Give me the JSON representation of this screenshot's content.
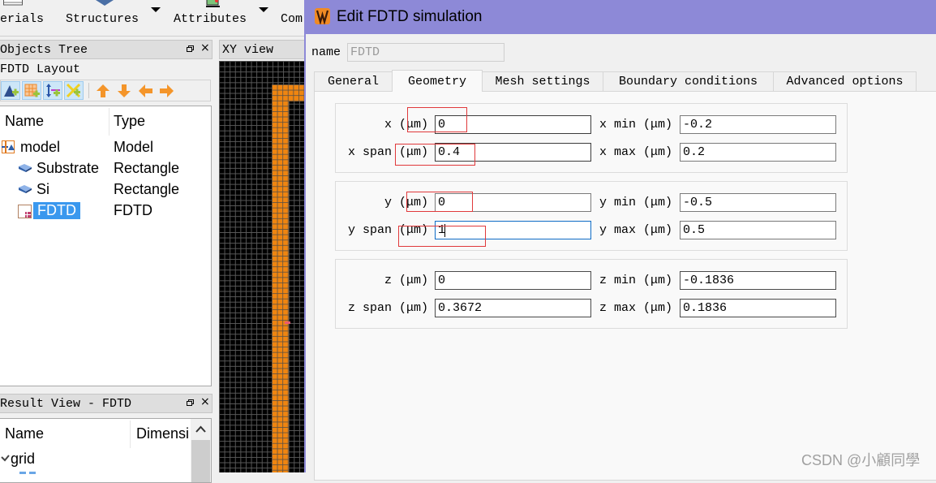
{
  "toolbar": {
    "items": [
      {
        "label": "erials",
        "icon": "table-icon"
      },
      {
        "label": "Structures",
        "icon": "structure-icon",
        "has_dropdown": true
      },
      {
        "label": "Attributes",
        "icon": "attribute-icon",
        "has_dropdown": true
      },
      {
        "label": "Com"
      }
    ]
  },
  "objects_tree": {
    "title": "Objects Tree",
    "layout_label": "FDTD Layout",
    "toolbar_icons": [
      "add-structure-icon",
      "add-mesh-icon",
      "add-dimension-icon",
      "add-cross-icon",
      "move-up-icon",
      "move-down-icon",
      "move-left-icon",
      "move-right-icon"
    ],
    "columns": [
      "Name",
      "Type"
    ],
    "rows": [
      {
        "name": "model",
        "type": "Model",
        "icon": "model-icon"
      },
      {
        "name": "Substrate",
        "type": "Rectangle",
        "icon": "rectangle-icon"
      },
      {
        "name": "Si",
        "type": "Rectangle",
        "icon": "rectangle-icon"
      },
      {
        "name": "FDTD",
        "type": "FDTD",
        "icon": "fdtd-icon",
        "selected": true
      }
    ]
  },
  "result_view": {
    "title": "Result View - FDTD",
    "columns": [
      "Name",
      "Dimensi"
    ],
    "rows": [
      {
        "name": "grid",
        "expanded": true
      }
    ]
  },
  "xy_view": {
    "title": "XY view"
  },
  "dialog": {
    "title": "Edit FDTD simulation",
    "name_label": "name",
    "name_value": "FDTD",
    "tabs": [
      {
        "label": "General"
      },
      {
        "label": "Geometry",
        "active": true
      },
      {
        "label": "Mesh settings"
      },
      {
        "label": "Boundary conditions"
      },
      {
        "label": "Advanced options"
      }
    ],
    "groups": [
      {
        "rows": [
          {
            "label": "x (μm)",
            "value": "0",
            "right_label": "x min (μm)",
            "right_value": "-0.2"
          },
          {
            "label": "x span (μm)",
            "value": "0.4",
            "right_label": "x max (μm)",
            "right_value": "0.2"
          }
        ]
      },
      {
        "rows": [
          {
            "label": "y (μm)",
            "value": "0",
            "right_label": "y min (μm)",
            "right_value": "-0.5"
          },
          {
            "label": "y span (μm)",
            "value": "1",
            "right_label": "y max (μm)",
            "right_value": "0.5",
            "focused": true
          }
        ]
      },
      {
        "rows": [
          {
            "label": "z (μm)",
            "value": "0",
            "right_label": "z min (μm)",
            "right_value": "-0.1836"
          },
          {
            "label": "z span (μm)",
            "value": "0.3672",
            "right_label": "z max (μm)",
            "right_value": "0.1836"
          }
        ]
      }
    ]
  },
  "watermark": "CSDN @小顧同學",
  "colors": {
    "dialog_titlebar": "#8d89d7",
    "selection": "#3a98ee",
    "structure_orange": "#ef8510",
    "annotation_red": "#e0393b",
    "focus_blue": "#0f6cc6"
  }
}
